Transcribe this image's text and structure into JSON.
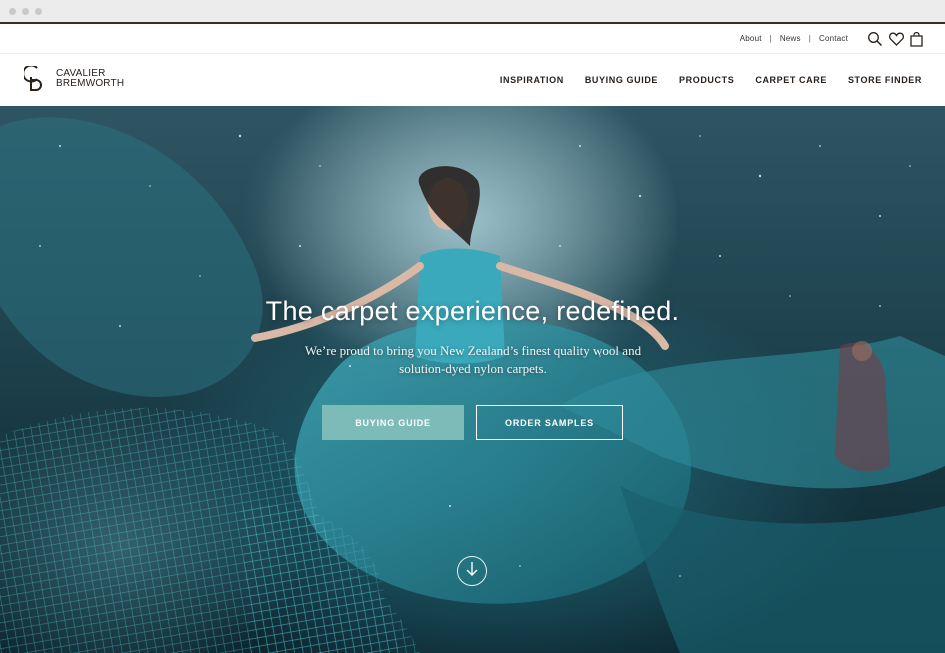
{
  "utility": {
    "links": [
      "About",
      "News",
      "Contact"
    ],
    "separator": "|",
    "icons": [
      "search-icon",
      "heart-icon",
      "bag-icon"
    ]
  },
  "brand": {
    "line1": "CAVALIER",
    "line2": "BREMWORTH",
    "color": "#2a211b"
  },
  "nav": {
    "items": [
      "INSPIRATION",
      "BUYING GUIDE",
      "PRODUCTS",
      "CARPET CARE",
      "STORE FINDER"
    ]
  },
  "hero": {
    "title": "The carpet experience, redefined.",
    "subtitle": "We’re proud to bring you New Zealand’s finest quality wool and solution-dyed nylon carpets.",
    "primary_button": "BUYING GUIDE",
    "secondary_button": "ORDER SAMPLES",
    "scroll_icon": "arrow-down-circle-icon",
    "accent_color": "#7dbbb8"
  }
}
